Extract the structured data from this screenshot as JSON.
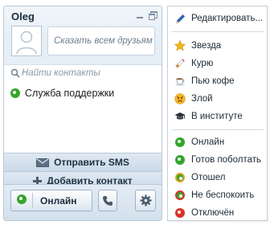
{
  "profile": {
    "username": "Oleg",
    "status_placeholder": "Сказать всем друзьям"
  },
  "search": {
    "placeholder": "Найти контакты"
  },
  "contacts": [
    {
      "name": "Служба поддержки",
      "status": "online"
    }
  ],
  "actions": {
    "send_sms": "Отправить SMS",
    "add_contact": "Добавить контакт"
  },
  "bottom_bar": {
    "status_button": "Онлайн"
  },
  "menu": {
    "edit": "Редактировать...",
    "moods": [
      {
        "label": "Звезда",
        "icon": "star-icon"
      },
      {
        "label": "Курю",
        "icon": "cigarette-icon"
      },
      {
        "label": "Пью кофе",
        "icon": "coffee-icon"
      },
      {
        "label": "Злой",
        "icon": "angry-face-icon"
      },
      {
        "label": "В институте",
        "icon": "graduation-cap-icon"
      }
    ],
    "statuses": [
      {
        "label": "Онлайн",
        "key": "online"
      },
      {
        "label": "Готов поболтать",
        "key": "chat"
      },
      {
        "label": "Отошел",
        "key": "away"
      },
      {
        "label": "Не беспокоить",
        "key": "dnd"
      },
      {
        "label": "Отключён",
        "key": "offline"
      }
    ]
  },
  "colors": {
    "online_green": "#33a52b",
    "away_orange": "#e0a420",
    "busy_red": "#d8332a",
    "panel_border": "#b9c8d6"
  }
}
